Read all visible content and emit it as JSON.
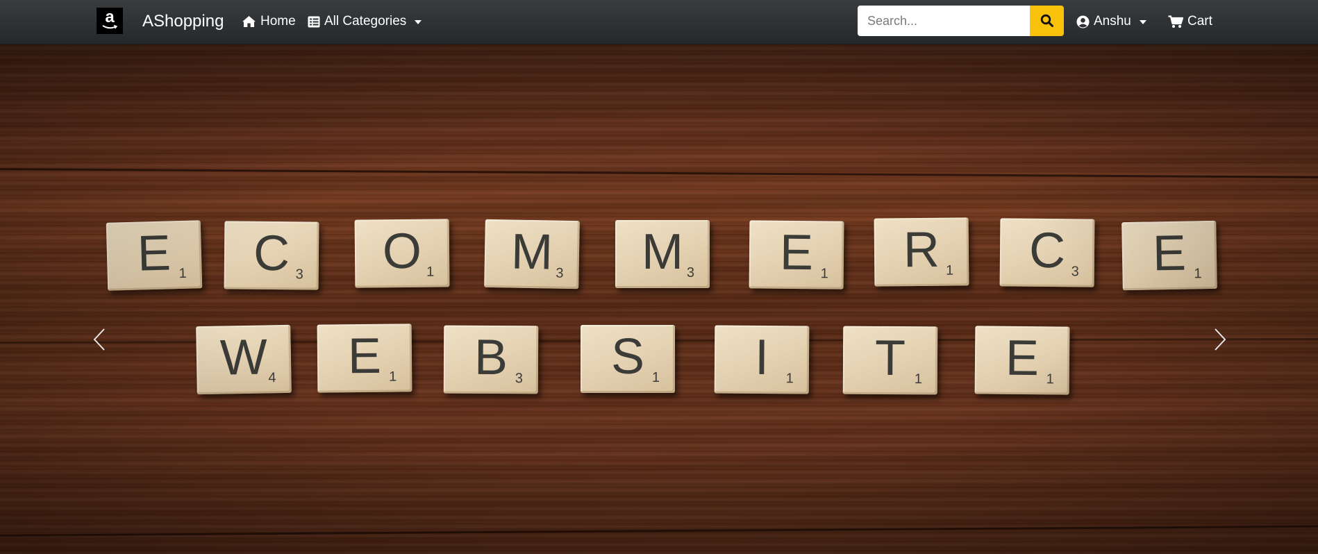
{
  "navbar": {
    "logo_letter": "a",
    "brand": "AShopping",
    "home_label": "Home",
    "categories_label": "All Categories",
    "search_placeholder": "Search...",
    "user_label": "Anshu",
    "cart_label": "Cart",
    "accent_color": "#f8c10a"
  },
  "hero": {
    "row1": [
      {
        "letter": "E",
        "points": "1"
      },
      {
        "letter": "C",
        "points": "3"
      },
      {
        "letter": "O",
        "points": "1"
      },
      {
        "letter": "M",
        "points": "3"
      },
      {
        "letter": "M",
        "points": "3"
      },
      {
        "letter": "E",
        "points": "1"
      },
      {
        "letter": "R",
        "points": "1"
      },
      {
        "letter": "C",
        "points": "3"
      },
      {
        "letter": "E",
        "points": "1"
      }
    ],
    "row2": [
      {
        "letter": "W",
        "points": "4"
      },
      {
        "letter": "E",
        "points": "1"
      },
      {
        "letter": "B",
        "points": "3"
      },
      {
        "letter": "S",
        "points": "1"
      },
      {
        "letter": "I",
        "points": "1"
      },
      {
        "letter": "T",
        "points": "1"
      },
      {
        "letter": "E",
        "points": "1"
      }
    ],
    "prev_icon": "chevron-left-icon",
    "next_icon": "chevron-right-icon"
  }
}
